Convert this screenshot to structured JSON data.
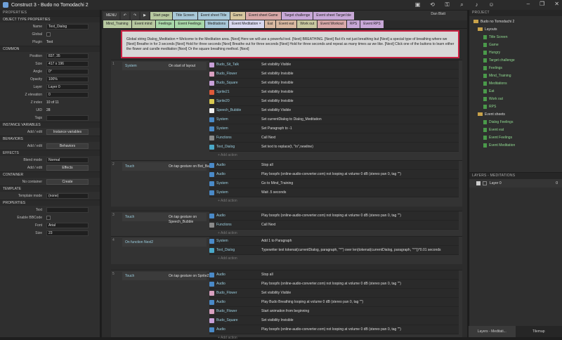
{
  "app": {
    "title": "Construct 3 - Budo no Tomodachi 2",
    "user": "Dan Blatt"
  },
  "left_panel": {
    "header": "PROPERTIES",
    "sections": [
      {
        "title": "OBJECT TYPE PROPERTIES",
        "rows": [
          {
            "label": "Name",
            "value": "Text_Dialog",
            "kind": "box"
          },
          {
            "label": "Global",
            "value": "",
            "kind": "chk"
          },
          {
            "label": "Plugin",
            "value": "Text",
            "kind": "text"
          }
        ]
      },
      {
        "title": "COMMON",
        "rows": [
          {
            "label": "Position",
            "value": "837, 35",
            "kind": "box"
          },
          {
            "label": "Size",
            "value": "417 x 196",
            "kind": "box"
          },
          {
            "label": "Angle",
            "value": "0°",
            "kind": "box"
          },
          {
            "label": "Opacity",
            "value": "100%",
            "kind": "box"
          },
          {
            "label": "Layer",
            "value": "Layer 0",
            "kind": "box"
          },
          {
            "label": "Z elevation",
            "value": "0",
            "kind": "box"
          },
          {
            "label": "Z index",
            "value": "10 of 11",
            "kind": "text"
          },
          {
            "label": "UID",
            "value": "28",
            "kind": "text"
          },
          {
            "label": "Tags",
            "value": "",
            "kind": "box"
          }
        ]
      },
      {
        "title": "INSTANCE VARIABLES",
        "rows": [
          {
            "label": "Add / edit",
            "value": "Instance variables",
            "kind": "btn"
          }
        ]
      },
      {
        "title": "BEHAVIORS",
        "rows": [
          {
            "label": "Add / edit",
            "value": "Behaviors",
            "kind": "btn"
          }
        ]
      },
      {
        "title": "EFFECTS",
        "rows": [
          {
            "label": "Blend mode",
            "value": "Normal",
            "kind": "box"
          },
          {
            "label": "Add / edit",
            "value": "Effects",
            "kind": "btn"
          }
        ]
      },
      {
        "title": "CONTAINER",
        "rows": [
          {
            "label": "No container",
            "value": "Create",
            "kind": "btn"
          }
        ]
      },
      {
        "title": "TEMPLATE",
        "rows": [
          {
            "label": "Template mode",
            "value": "(none)",
            "kind": "box"
          }
        ]
      },
      {
        "title": "PROPERTIES",
        "rows": [
          {
            "label": "Text",
            "value": "",
            "kind": "box"
          },
          {
            "label": "Enable BBCode",
            "value": "",
            "kind": "chk"
          },
          {
            "label": "Font",
            "value": "Arial",
            "kind": "box"
          },
          {
            "label": "Size",
            "value": "23",
            "kind": "box"
          }
        ]
      }
    ]
  },
  "toolbar": {
    "menu": "MENU",
    "tabs": [
      {
        "label": "Start page",
        "color": "#b8c9a0"
      },
      {
        "label": "Title Screen",
        "color": "#a8c8d8"
      },
      {
        "label": "Event sheet Title",
        "color": "#a8c8d8"
      },
      {
        "label": "Game",
        "color": "#d8c8a0"
      },
      {
        "label": "Event sheet Game",
        "color": "#d8a8a8"
      },
      {
        "label": "Target challenge",
        "color": "#c8a8d8"
      },
      {
        "label": "Event sheet Target ble",
        "color": "#c8a8d8"
      }
    ]
  },
  "tabs2": [
    {
      "label": "Mind_Training",
      "color": "#b8c9a0"
    },
    {
      "label": "Event mind",
      "color": "#b8c9a0"
    },
    {
      "label": "Feelings",
      "color": "#a8d8a8"
    },
    {
      "label": "Event Feelings",
      "color": "#a8d8a8"
    },
    {
      "label": "Meditations",
      "color": "#a8c8d8"
    },
    {
      "label": "Event Meditation ×",
      "color": "#d8d8f0"
    },
    {
      "label": "Eat",
      "color": "#d8b8a0"
    },
    {
      "label": "Event eat",
      "color": "#d8b8a0"
    },
    {
      "label": "Work out",
      "color": "#c8c8a0"
    },
    {
      "label": "Event Workout",
      "color": "#d8a8a8"
    },
    {
      "label": "RPS",
      "color": "#c8a8d8"
    },
    {
      "label": "Event RPS",
      "color": "#c8a8d8"
    }
  ],
  "comment": "Global string Dialog_Meditation = Welcome to the Meditation area. [Next] Here we will use a powerful tool. [Next] BREATHING. [Next] But it's not just breathing but [Next] a special type of breathing where we [Next] Breathe in for 3 seconds [Next] Hold for three seconds [Next] Breathe out for three seconds [Next] Hold for three seconds and repeat as many times as we like. [Next] Click one of the buttons to learn either the flower and candle meditation [Next] Or the square breathing method. [Next]",
  "events": [
    {
      "num": "1",
      "cond_obj": "System",
      "cond_text": "On start of layout",
      "actions": [
        {
          "obj": "Budo_Sit_Talk",
          "text": "Set visibility Visible",
          "color": "#c8a0d8"
        },
        {
          "obj": "Budo_Flower",
          "text": "Set visibility Invisible",
          "color": "#d8a0c0"
        },
        {
          "obj": "Budo_Square",
          "text": "Set visibility Invisible",
          "color": "#c8a0d8"
        },
        {
          "obj": "Sprite21",
          "text": "Set visibility Invisible",
          "color": "#e05a3a"
        },
        {
          "obj": "Sprite20",
          "text": "Set visibility Invisible",
          "color": "#d8c850"
        },
        {
          "obj": "Speech_Bubble",
          "text": "Set visibility Visible",
          "color": "#eeeeee"
        },
        {
          "obj": "System",
          "text": "Set currentDialog to Dialog_Meditation",
          "color": "#4a8ac8"
        },
        {
          "obj": "System",
          "text": "Set Paragraph to -1",
          "color": "#4a8ac8"
        },
        {
          "obj": "Functions",
          "text": "Call Next",
          "color": "#8a8a8a"
        },
        {
          "obj": "Text_Dialog",
          "text": "Set text to replace(t, \"\\n\",newline)",
          "color": "#4aa8c8"
        }
      ]
    },
    {
      "num": "2",
      "cond_obj": "Touch",
      "cond_text": "On tap gesture on Bot_Back",
      "actions": [
        {
          "obj": "Audio",
          "text": "Stop all",
          "color": "#4a8ac8"
        },
        {
          "obj": "Audio",
          "text": "Play boopfx (online-audio-converter.com) not looping at volume 0 dB (stereo pan 0, tag \"\")",
          "color": "#4a8ac8"
        },
        {
          "obj": "System",
          "text": "Go to Mind_Training",
          "color": "#4a8ac8"
        },
        {
          "obj": "System",
          "text": "Wait .5 seconds",
          "color": "#4a8ac8"
        }
      ]
    },
    {
      "num": "3",
      "cond_obj": "Touch",
      "cond_text": "On tap gesture on Speech_Bubble",
      "actions": [
        {
          "obj": "Audio",
          "text": "Play boopfx (online-audio-converter.com) not looping at volume 0 dB (stereo pan 0, tag \"\")",
          "color": "#4a8ac8"
        },
        {
          "obj": "Functions",
          "text": "Call Next",
          "color": "#8a8a8a"
        }
      ]
    },
    {
      "num": "4",
      "cond_obj": "On function Next2",
      "cond_text": "",
      "actions": [
        {
          "obj": "System",
          "text": "Add 1 to Paragraph",
          "color": "#4a8ac8"
        },
        {
          "obj": "Text_Dialog",
          "text": "Typewriter text tokenat(currentDialog, paragraph, \"^\") over len(tokenat(currentDialog, paragraph, \"^\"))*0.01 seconds",
          "color": "#4aa8c8"
        }
      ]
    },
    {
      "num": "5",
      "cond_obj": "Touch",
      "cond_text": "On tap gesture on Sprite21",
      "actions": [
        {
          "obj": "Audio",
          "text": "Stop all",
          "color": "#4a8ac8"
        },
        {
          "obj": "Audio",
          "text": "Play boopfx (online-audio-converter.com) not looping at volume 0 dB (stereo pan 0, tag \"\")",
          "color": "#4a8ac8"
        },
        {
          "obj": "Budo_Flower",
          "text": "Set visibility Visible",
          "color": "#d8a0c0"
        },
        {
          "obj": "Audio",
          "text": "Play Budo Breathing looping at volume 0 dB (stereo pan 0, tag \"\")",
          "color": "#4a8ac8"
        },
        {
          "obj": "Budo_Flower",
          "text": "Start animation from beginning",
          "color": "#d8a0c0"
        },
        {
          "obj": "Budo_Square",
          "text": "Set visibility Invisible",
          "color": "#c8a0d8"
        },
        {
          "obj": "Audio",
          "text": "Play boopfx (online-audio-converter.com) not looping at volume 0 dB (stereo pan 0, tag \"\")",
          "color": "#4a8ac8"
        }
      ]
    }
  ],
  "add_action": "+ Add action",
  "project": {
    "header": "PROJECT",
    "root": "Budo no Tomodachi 2",
    "layouts_label": "Layouts",
    "layouts": [
      "Title Screen",
      "Game",
      "Hungry",
      "Target challenge",
      "Feelings",
      "Mind_Training",
      "Meditations",
      "Eat",
      "Work out",
      "RPS"
    ],
    "eventsheets_label": "Event sheets",
    "eventsheets": [
      "Dialog Feelings",
      "Event eat",
      "Event Feelings",
      "Event Meditation"
    ]
  },
  "layers": {
    "header": "LAYERS - MEDITATIONS",
    "row": "Layer 0",
    "row_num": "0"
  },
  "bottom_tabs": [
    "Layers - Meditati...",
    "Tilemap"
  ]
}
